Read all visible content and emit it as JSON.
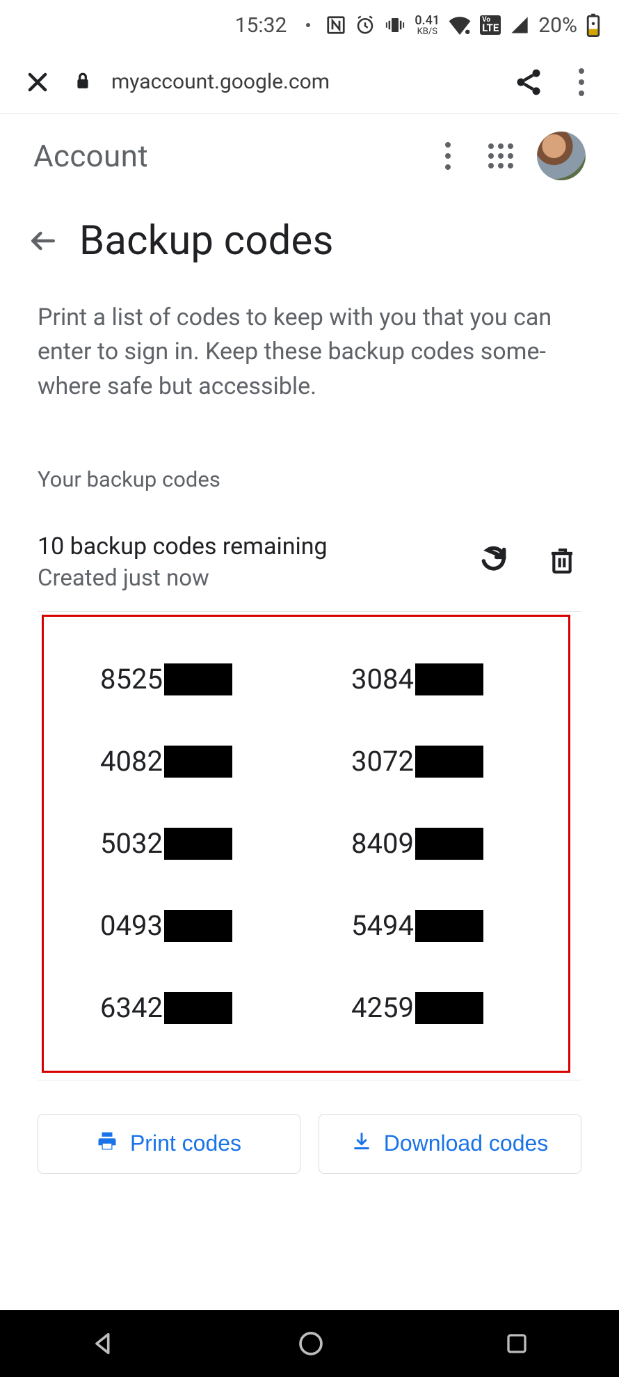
{
  "status_bar": {
    "time": "15:32",
    "net_speed_value": "0.41",
    "net_speed_unit": "KB/S",
    "lte_vo": "Vo",
    "lte_label": "LTE",
    "battery_pct": "20%"
  },
  "browser": {
    "url": "myaccount.google.com"
  },
  "account_header": {
    "title": "Account"
  },
  "page": {
    "title": "Backup codes",
    "description": "Print a list of codes to keep with you that you can enter to sign in. Keep these backup codes some­where safe but accessible.",
    "section_label": "Your backup codes",
    "remaining": "10 backup codes remaining",
    "created": "Created just now"
  },
  "codes": {
    "left": [
      "8525",
      "4082",
      "5032",
      "0493",
      "6342"
    ],
    "right": [
      "3084",
      "3072",
      "8409",
      "5494",
      "4259"
    ]
  },
  "buttons": {
    "print": "Print codes",
    "download": "Download codes"
  }
}
